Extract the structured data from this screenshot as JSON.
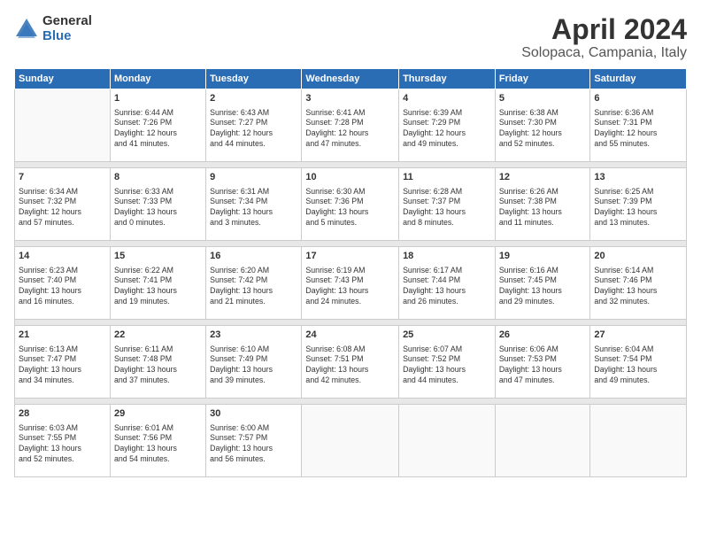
{
  "header": {
    "logo_general": "General",
    "logo_blue": "Blue",
    "title": "April 2024",
    "location": "Solopaca, Campania, Italy"
  },
  "calendar": {
    "days_of_week": [
      "Sunday",
      "Monday",
      "Tuesday",
      "Wednesday",
      "Thursday",
      "Friday",
      "Saturday"
    ],
    "weeks": [
      [
        {
          "day": "",
          "info": ""
        },
        {
          "day": "1",
          "info": "Sunrise: 6:44 AM\nSunset: 7:26 PM\nDaylight: 12 hours\nand 41 minutes."
        },
        {
          "day": "2",
          "info": "Sunrise: 6:43 AM\nSunset: 7:27 PM\nDaylight: 12 hours\nand 44 minutes."
        },
        {
          "day": "3",
          "info": "Sunrise: 6:41 AM\nSunset: 7:28 PM\nDaylight: 12 hours\nand 47 minutes."
        },
        {
          "day": "4",
          "info": "Sunrise: 6:39 AM\nSunset: 7:29 PM\nDaylight: 12 hours\nand 49 minutes."
        },
        {
          "day": "5",
          "info": "Sunrise: 6:38 AM\nSunset: 7:30 PM\nDaylight: 12 hours\nand 52 minutes."
        },
        {
          "day": "6",
          "info": "Sunrise: 6:36 AM\nSunset: 7:31 PM\nDaylight: 12 hours\nand 55 minutes."
        }
      ],
      [
        {
          "day": "7",
          "info": "Sunrise: 6:34 AM\nSunset: 7:32 PM\nDaylight: 12 hours\nand 57 minutes."
        },
        {
          "day": "8",
          "info": "Sunrise: 6:33 AM\nSunset: 7:33 PM\nDaylight: 13 hours\nand 0 minutes."
        },
        {
          "day": "9",
          "info": "Sunrise: 6:31 AM\nSunset: 7:34 PM\nDaylight: 13 hours\nand 3 minutes."
        },
        {
          "day": "10",
          "info": "Sunrise: 6:30 AM\nSunset: 7:36 PM\nDaylight: 13 hours\nand 5 minutes."
        },
        {
          "day": "11",
          "info": "Sunrise: 6:28 AM\nSunset: 7:37 PM\nDaylight: 13 hours\nand 8 minutes."
        },
        {
          "day": "12",
          "info": "Sunrise: 6:26 AM\nSunset: 7:38 PM\nDaylight: 13 hours\nand 11 minutes."
        },
        {
          "day": "13",
          "info": "Sunrise: 6:25 AM\nSunset: 7:39 PM\nDaylight: 13 hours\nand 13 minutes."
        }
      ],
      [
        {
          "day": "14",
          "info": "Sunrise: 6:23 AM\nSunset: 7:40 PM\nDaylight: 13 hours\nand 16 minutes."
        },
        {
          "day": "15",
          "info": "Sunrise: 6:22 AM\nSunset: 7:41 PM\nDaylight: 13 hours\nand 19 minutes."
        },
        {
          "day": "16",
          "info": "Sunrise: 6:20 AM\nSunset: 7:42 PM\nDaylight: 13 hours\nand 21 minutes."
        },
        {
          "day": "17",
          "info": "Sunrise: 6:19 AM\nSunset: 7:43 PM\nDaylight: 13 hours\nand 24 minutes."
        },
        {
          "day": "18",
          "info": "Sunrise: 6:17 AM\nSunset: 7:44 PM\nDaylight: 13 hours\nand 26 minutes."
        },
        {
          "day": "19",
          "info": "Sunrise: 6:16 AM\nSunset: 7:45 PM\nDaylight: 13 hours\nand 29 minutes."
        },
        {
          "day": "20",
          "info": "Sunrise: 6:14 AM\nSunset: 7:46 PM\nDaylight: 13 hours\nand 32 minutes."
        }
      ],
      [
        {
          "day": "21",
          "info": "Sunrise: 6:13 AM\nSunset: 7:47 PM\nDaylight: 13 hours\nand 34 minutes."
        },
        {
          "day": "22",
          "info": "Sunrise: 6:11 AM\nSunset: 7:48 PM\nDaylight: 13 hours\nand 37 minutes."
        },
        {
          "day": "23",
          "info": "Sunrise: 6:10 AM\nSunset: 7:49 PM\nDaylight: 13 hours\nand 39 minutes."
        },
        {
          "day": "24",
          "info": "Sunrise: 6:08 AM\nSunset: 7:51 PM\nDaylight: 13 hours\nand 42 minutes."
        },
        {
          "day": "25",
          "info": "Sunrise: 6:07 AM\nSunset: 7:52 PM\nDaylight: 13 hours\nand 44 minutes."
        },
        {
          "day": "26",
          "info": "Sunrise: 6:06 AM\nSunset: 7:53 PM\nDaylight: 13 hours\nand 47 minutes."
        },
        {
          "day": "27",
          "info": "Sunrise: 6:04 AM\nSunset: 7:54 PM\nDaylight: 13 hours\nand 49 minutes."
        }
      ],
      [
        {
          "day": "28",
          "info": "Sunrise: 6:03 AM\nSunset: 7:55 PM\nDaylight: 13 hours\nand 52 minutes."
        },
        {
          "day": "29",
          "info": "Sunrise: 6:01 AM\nSunset: 7:56 PM\nDaylight: 13 hours\nand 54 minutes."
        },
        {
          "day": "30",
          "info": "Sunrise: 6:00 AM\nSunset: 7:57 PM\nDaylight: 13 hours\nand 56 minutes."
        },
        {
          "day": "",
          "info": ""
        },
        {
          "day": "",
          "info": ""
        },
        {
          "day": "",
          "info": ""
        },
        {
          "day": "",
          "info": ""
        }
      ]
    ]
  }
}
